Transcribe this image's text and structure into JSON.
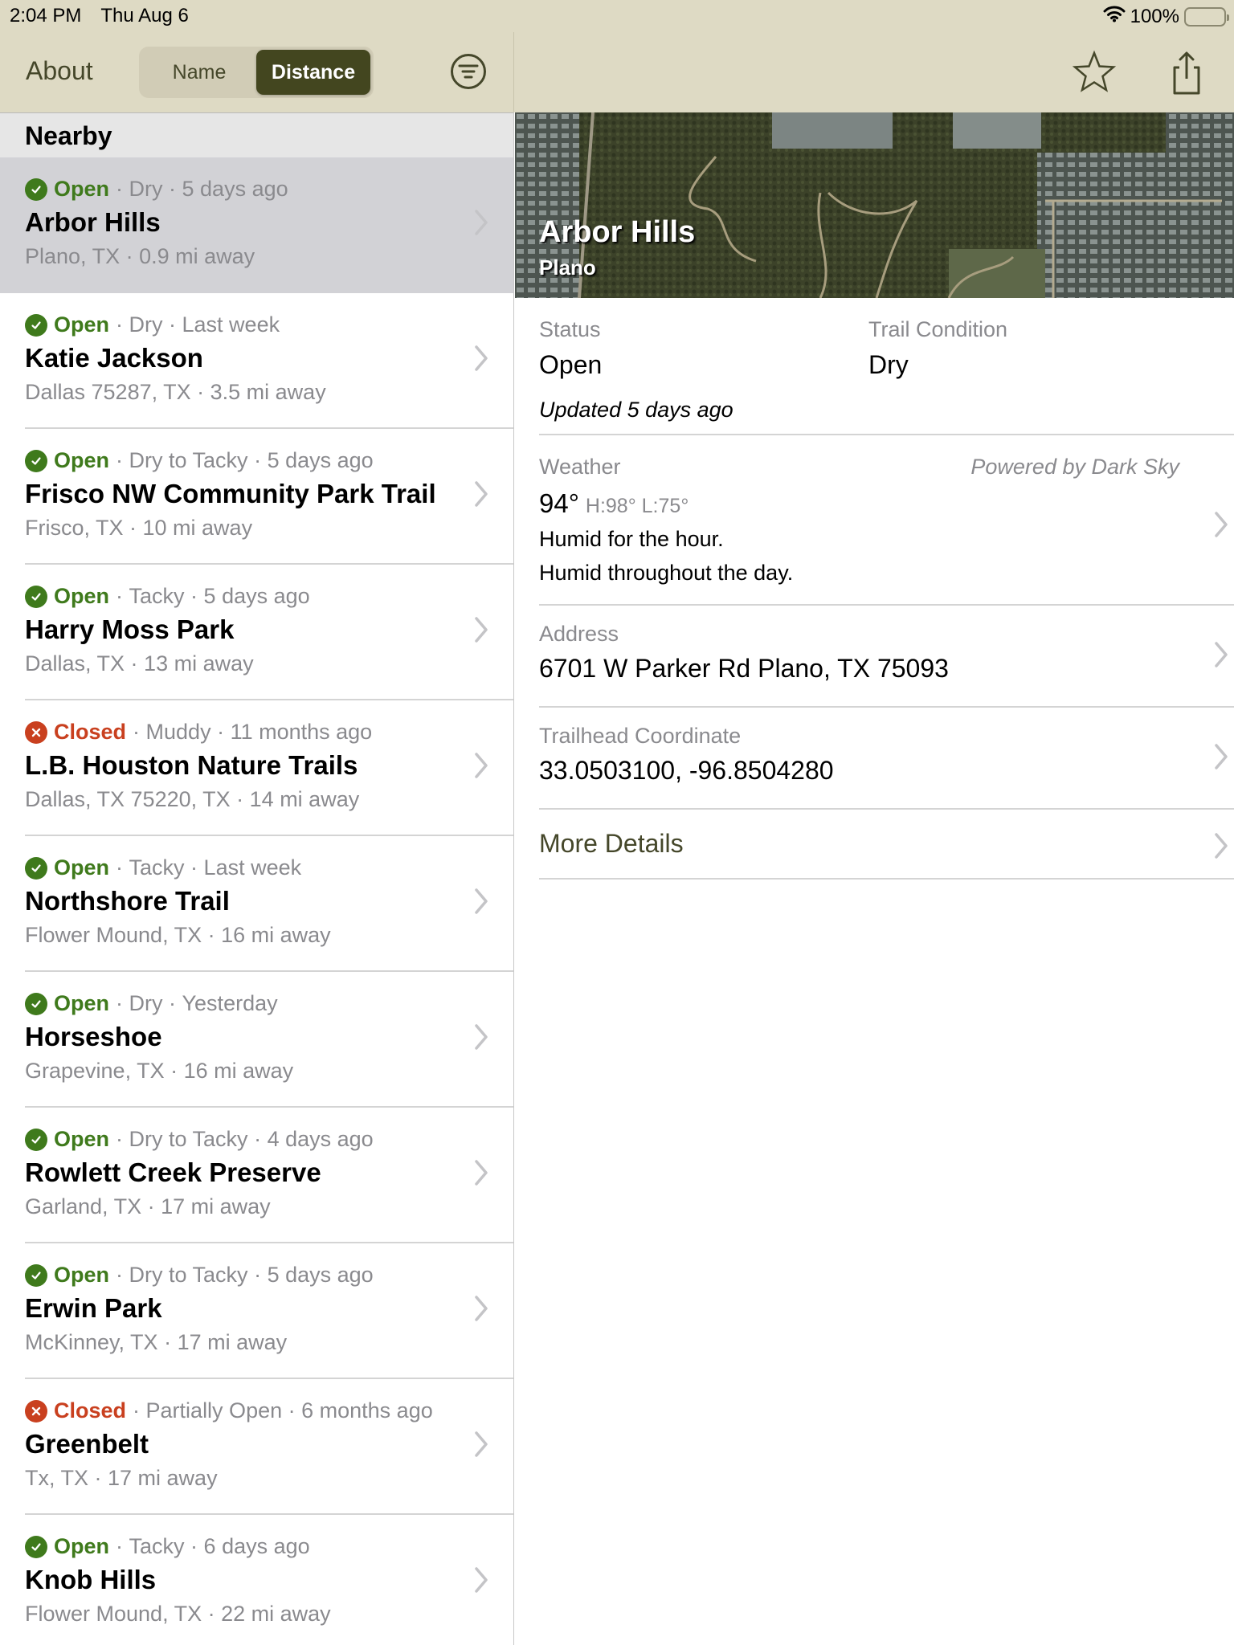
{
  "status_bar": {
    "time": "2:04 PM",
    "date": "Thu Aug 6",
    "battery": "100%"
  },
  "nav": {
    "about_label": "About",
    "sort_options": [
      {
        "label": "Name",
        "selected": false
      },
      {
        "label": "Distance",
        "selected": true
      }
    ]
  },
  "list": {
    "section_title": "Nearby",
    "items": [
      {
        "status": "Open",
        "condition": "Dry",
        "updated": "5 days ago",
        "name": "Arbor Hills",
        "location": "Plano, TX",
        "distance": "0.9 mi away",
        "selected": true
      },
      {
        "status": "Open",
        "condition": "Dry",
        "updated": "Last week",
        "name": "Katie Jackson",
        "location": "Dallas 75287, TX",
        "distance": "3.5 mi away"
      },
      {
        "status": "Open",
        "condition": "Dry to Tacky",
        "updated": "5 days ago",
        "name": "Frisco NW Community Park Trail",
        "location": "Frisco, TX",
        "distance": "10 mi away"
      },
      {
        "status": "Open",
        "condition": "Tacky",
        "updated": "5 days ago",
        "name": "Harry Moss Park",
        "location": "Dallas, TX",
        "distance": "13 mi away"
      },
      {
        "status": "Closed",
        "condition": "Muddy",
        "updated": "11 months ago",
        "name": "L.B. Houston Nature Trails",
        "location": "Dallas, TX  75220, TX",
        "distance": "14 mi away"
      },
      {
        "status": "Open",
        "condition": "Tacky",
        "updated": "Last week",
        "name": "Northshore Trail",
        "location": "Flower Mound, TX",
        "distance": "16 mi away"
      },
      {
        "status": "Open",
        "condition": "Dry",
        "updated": "Yesterday",
        "name": "Horseshoe",
        "location": "Grapevine, TX",
        "distance": "16 mi away"
      },
      {
        "status": "Open",
        "condition": "Dry to Tacky",
        "updated": "4 days ago",
        "name": "Rowlett Creek Preserve",
        "location": "Garland, TX",
        "distance": "17 mi away"
      },
      {
        "status": "Open",
        "condition": "Dry to Tacky",
        "updated": "5 days ago",
        "name": "Erwin Park",
        "location": "McKinney, TX",
        "distance": "17 mi away"
      },
      {
        "status": "Closed",
        "condition": "Partially Open",
        "updated": "6 months ago",
        "name": "Greenbelt",
        "location": "Tx, TX",
        "distance": "17 mi away"
      },
      {
        "status": "Open",
        "condition": "Tacky",
        "updated": "6 days ago",
        "name": "Knob Hills",
        "location": "Flower Mound, TX",
        "distance": "22 mi away"
      }
    ]
  },
  "detail": {
    "title": "Arbor Hills",
    "subtitle": "Plano",
    "status_label": "Status",
    "status_value": "Open",
    "condition_label": "Trail Condition",
    "condition_value": "Dry",
    "updated": "Updated 5 days ago",
    "weather_label": "Weather",
    "weather_attribution": "Powered by Dark Sky",
    "temperature": "94°",
    "high_low": "H:98° L:75°",
    "weather_hour": "Humid for the hour.",
    "weather_day": "Humid throughout the day.",
    "address_label": "Address",
    "address_value": "6701 W Parker Rd Plano, TX 75093",
    "coordinate_label": "Trailhead Coordinate",
    "coordinate_value": "33.0503100, -96.8504280",
    "more_details_label": "More Details"
  },
  "colors": {
    "accent": "#45472a",
    "bar_background": "#dedac4",
    "open_green": "#3f7a1c",
    "closed_red": "#c9401f",
    "secondary_text": "#8a8a8e"
  }
}
